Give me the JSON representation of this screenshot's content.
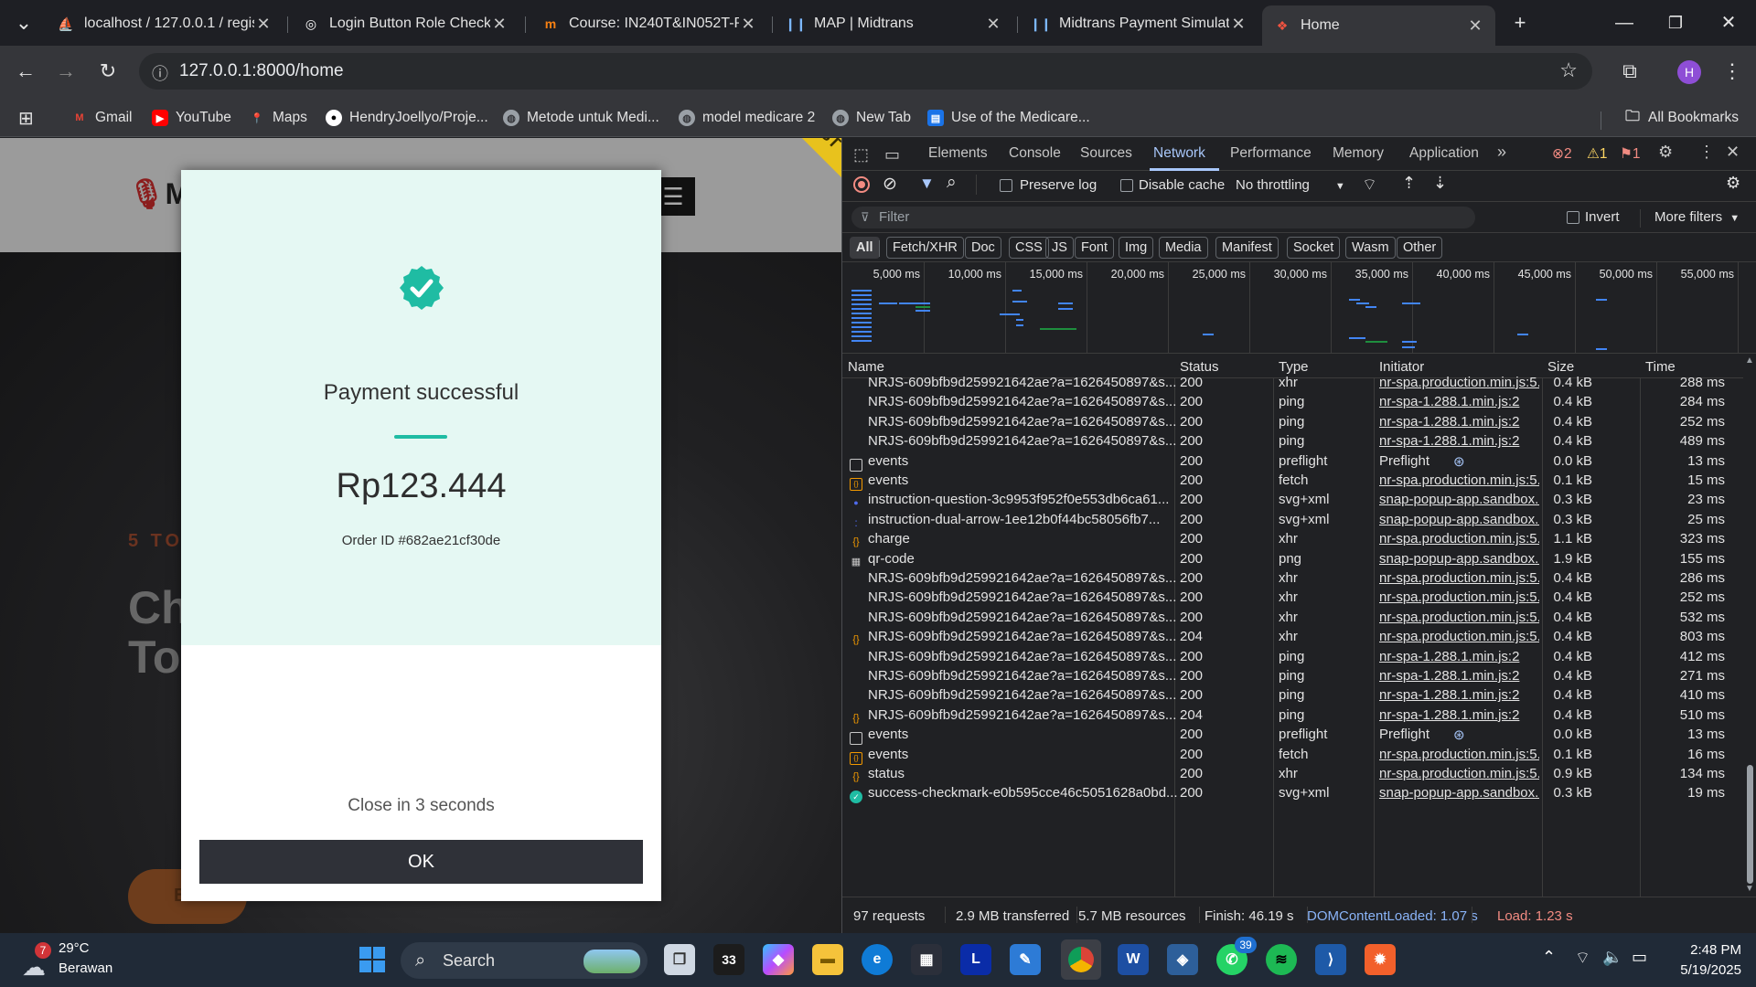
{
  "browser": {
    "tabs": [
      {
        "title": "localhost / 127.0.0.1 / regis",
        "icon": "phpmyadmin-icon"
      },
      {
        "title": "Login Button Role Check",
        "icon": "chatgpt-icon"
      },
      {
        "title": "Course: IN240T&IN052T-PI",
        "icon": "moodle-icon"
      },
      {
        "title": "MAP | Midtrans",
        "icon": "midtrans-icon"
      },
      {
        "title": "Midtrans Payment Simulat",
        "icon": "midtrans-icon"
      },
      {
        "title": "Home",
        "icon": "laravel-icon"
      }
    ],
    "url": "127.0.0.1:8000/home",
    "profile_initial": "H",
    "bookmarks": [
      {
        "label": "Gmail"
      },
      {
        "label": "YouTube"
      },
      {
        "label": "Maps"
      },
      {
        "label": "HendryJoellyo/Proje..."
      },
      {
        "label": "Metode untuk Medi..."
      },
      {
        "label": "model medicare 2"
      },
      {
        "label": "New Tab"
      },
      {
        "label": "Use of the Medicare..."
      }
    ],
    "all_bookmarks": "All Bookmarks"
  },
  "page": {
    "logo_letter": "M",
    "ribbon": "TEST",
    "hero_small": "5 TO",
    "hero_line1": "Ch",
    "hero_line2": "To",
    "hero_btn": "B"
  },
  "modal": {
    "title": "Payment successful",
    "amount": "Rp123.444",
    "order_id": "Order ID #682ae21cf30de",
    "close_text": "Close in 3 seconds",
    "ok_label": "OK",
    "accent": "#1fbca3"
  },
  "devtools": {
    "tabs": [
      "Elements",
      "Console",
      "Sources",
      "Network",
      "Performance",
      "Memory",
      "Application"
    ],
    "active_tab": "Network",
    "errors": "2",
    "warnings": "1",
    "issues": "1",
    "preserve_log": "Preserve log",
    "disable_cache": "Disable cache",
    "throttling": "No throttling",
    "filter_placeholder": "Filter",
    "invert": "Invert",
    "more_filters": "More filters",
    "types": [
      "All",
      "Fetch/XHR",
      "Doc",
      "CSS",
      "JS",
      "Font",
      "Img",
      "Media",
      "Manifest",
      "Socket",
      "Wasm",
      "Other"
    ],
    "overview_ticks": [
      "5,000 ms",
      "10,000 ms",
      "15,000 ms",
      "20,000 ms",
      "25,000 ms",
      "30,000 ms",
      "35,000 ms",
      "40,000 ms",
      "45,000 ms",
      "50,000 ms",
      "55,000 ms"
    ],
    "columns": [
      "Name",
      "Status",
      "Type",
      "Initiator",
      "Size",
      "Time"
    ],
    "rows": [
      {
        "icon": "",
        "name": "NRJS-609bfb9d259921642ae?a=1626450897&s...",
        "status": "200",
        "type": "xhr",
        "initiator": "nr-spa.production.min.js:5...",
        "size": "0.4 kB",
        "time": "288 ms"
      },
      {
        "icon": "",
        "name": "NRJS-609bfb9d259921642ae?a=1626450897&s...",
        "status": "200",
        "type": "ping",
        "initiator": "nr-spa-1.288.1.min.js:2",
        "size": "0.4 kB",
        "time": "284 ms"
      },
      {
        "icon": "",
        "name": "NRJS-609bfb9d259921642ae?a=1626450897&s...",
        "status": "200",
        "type": "ping",
        "initiator": "nr-spa-1.288.1.min.js:2",
        "size": "0.4 kB",
        "time": "252 ms"
      },
      {
        "icon": "",
        "name": "NRJS-609bfb9d259921642ae?a=1626450897&s...",
        "status": "200",
        "type": "ping",
        "initiator": "nr-spa-1.288.1.min.js:2",
        "size": "0.4 kB",
        "time": "489 ms"
      },
      {
        "icon": "doc",
        "name": "events",
        "status": "200",
        "type": "preflight",
        "initiator": "Preflight",
        "size": "0.0 kB",
        "time": "13 ms"
      },
      {
        "icon": "fetch",
        "name": "events",
        "status": "200",
        "type": "fetch",
        "initiator": "nr-spa.production.min.js:5...",
        "size": "0.1 kB",
        "time": "15 ms"
      },
      {
        "icon": "svg",
        "name": "instruction-question-3c9953f952f0e553db6ca61...",
        "status": "200",
        "type": "svg+xml",
        "initiator": "snap-popup-app.sandbox...",
        "size": "0.3 kB",
        "time": "23 ms"
      },
      {
        "icon": "svg2",
        "name": "instruction-dual-arrow-1ee12b0f44bc58056fb7...",
        "status": "200",
        "type": "svg+xml",
        "initiator": "snap-popup-app.sandbox...",
        "size": "0.3 kB",
        "time": "25 ms"
      },
      {
        "icon": "xhr",
        "name": "charge",
        "status": "200",
        "type": "xhr",
        "initiator": "nr-spa.production.min.js:5...",
        "size": "1.1 kB",
        "time": "323 ms"
      },
      {
        "icon": "img",
        "name": "qr-code",
        "status": "200",
        "type": "png",
        "initiator": "snap-popup-app.sandbox...",
        "size": "1.9 kB",
        "time": "155 ms"
      },
      {
        "icon": "",
        "name": "NRJS-609bfb9d259921642ae?a=1626450897&s...",
        "status": "200",
        "type": "xhr",
        "initiator": "nr-spa.production.min.js:5...",
        "size": "0.4 kB",
        "time": "286 ms"
      },
      {
        "icon": "",
        "name": "NRJS-609bfb9d259921642ae?a=1626450897&s...",
        "status": "200",
        "type": "xhr",
        "initiator": "nr-spa.production.min.js:5...",
        "size": "0.4 kB",
        "time": "252 ms"
      },
      {
        "icon": "",
        "name": "NRJS-609bfb9d259921642ae?a=1626450897&s...",
        "status": "200",
        "type": "xhr",
        "initiator": "nr-spa.production.min.js:5...",
        "size": "0.4 kB",
        "time": "532 ms"
      },
      {
        "icon": "xhr",
        "name": "NRJS-609bfb9d259921642ae?a=1626450897&s...",
        "status": "204",
        "type": "xhr",
        "initiator": "nr-spa.production.min.js:5...",
        "size": "0.4 kB",
        "time": "803 ms"
      },
      {
        "icon": "",
        "name": "NRJS-609bfb9d259921642ae?a=1626450897&s...",
        "status": "200",
        "type": "ping",
        "initiator": "nr-spa-1.288.1.min.js:2",
        "size": "0.4 kB",
        "time": "412 ms"
      },
      {
        "icon": "",
        "name": "NRJS-609bfb9d259921642ae?a=1626450897&s...",
        "status": "200",
        "type": "ping",
        "initiator": "nr-spa-1.288.1.min.js:2",
        "size": "0.4 kB",
        "time": "271 ms"
      },
      {
        "icon": "",
        "name": "NRJS-609bfb9d259921642ae?a=1626450897&s...",
        "status": "200",
        "type": "ping",
        "initiator": "nr-spa-1.288.1.min.js:2",
        "size": "0.4 kB",
        "time": "410 ms"
      },
      {
        "icon": "xhr",
        "name": "NRJS-609bfb9d259921642ae?a=1626450897&s...",
        "status": "204",
        "type": "ping",
        "initiator": "nr-spa-1.288.1.min.js:2",
        "size": "0.4 kB",
        "time": "510 ms"
      },
      {
        "icon": "doc",
        "name": "events",
        "status": "200",
        "type": "preflight",
        "initiator": "Preflight",
        "size": "0.0 kB",
        "time": "13 ms"
      },
      {
        "icon": "fetch",
        "name": "events",
        "status": "200",
        "type": "fetch",
        "initiator": "nr-spa.production.min.js:5...",
        "size": "0.1 kB",
        "time": "16 ms"
      },
      {
        "icon": "xhr",
        "name": "status",
        "status": "200",
        "type": "xhr",
        "initiator": "nr-spa.production.min.js:5...",
        "size": "0.9 kB",
        "time": "134 ms"
      },
      {
        "icon": "check",
        "name": "success-checkmark-e0b595cce46c5051628a0bd...",
        "status": "200",
        "type": "svg+xml",
        "initiator": "snap-popup-app.sandbox...",
        "size": "0.3 kB",
        "time": "19 ms"
      }
    ],
    "status_bar": {
      "requests": "97 requests",
      "transferred": "2.9 MB transferred",
      "resources": "5.7 MB resources",
      "finish": "Finish: 46.19 s",
      "dcl": "DOMContentLoaded: 1.07 s",
      "load": "Load: 1.23 s"
    }
  },
  "taskbar": {
    "weather_temp": "29°C",
    "weather_desc": "Berawan",
    "weather_badge": "7",
    "search": "Search",
    "whatsapp_badge": "39",
    "time": "2:48 PM",
    "date": "5/19/2025"
  }
}
